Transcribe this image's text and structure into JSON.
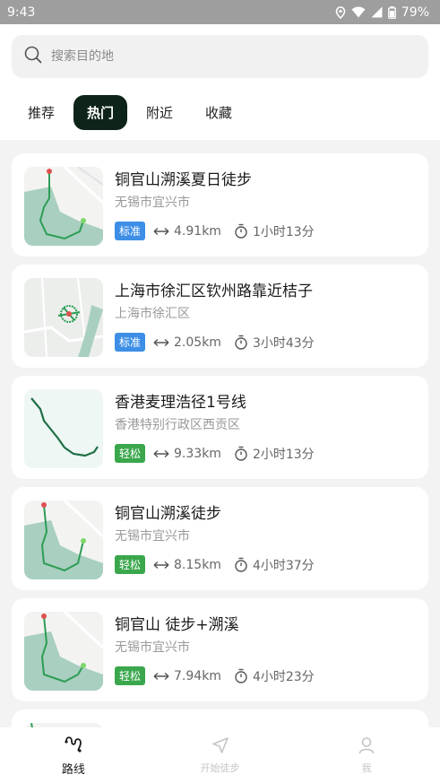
{
  "status_bar": {
    "time": "9:43",
    "battery": "79%"
  },
  "search": {
    "placeholder": "搜索目的地"
  },
  "tabs": [
    {
      "label": "推荐"
    },
    {
      "label": "热门",
      "active": true
    },
    {
      "label": "附近"
    },
    {
      "label": "收藏"
    }
  ],
  "routes": [
    {
      "title": "铜官山溯溪夏日徒步",
      "location": "无锡市宜兴市",
      "difficulty": "标准",
      "difficulty_color": "#3d8ee6",
      "distance": "4.91km",
      "duration": "1小时13分"
    },
    {
      "title": "上海市徐汇区钦州路靠近桔子",
      "location": "上海市徐汇区",
      "difficulty": "标准",
      "difficulty_color": "#3d8ee6",
      "distance": "2.05km",
      "duration": "3小时43分"
    },
    {
      "title": "香港麦理浩径1号线",
      "location": "香港特别行政区西贡区",
      "difficulty": "轻松",
      "difficulty_color": "#3aa74c",
      "distance": "9.33km",
      "duration": "2小时13分"
    },
    {
      "title": "铜官山溯溪徒步",
      "location": "无锡市宜兴市",
      "difficulty": "轻松",
      "difficulty_color": "#3aa74c",
      "distance": "8.15km",
      "duration": "4小时37分"
    },
    {
      "title": "铜官山 徒步+溯溪",
      "location": "无锡市宜兴市",
      "difficulty": "轻松",
      "difficulty_color": "#3aa74c",
      "distance": "7.94km",
      "duration": "4小时23分"
    }
  ],
  "bottom_nav": [
    {
      "label": "路线",
      "icon": "route-icon",
      "active": true
    },
    {
      "label": "开始徒步",
      "icon": "navigation-arrow-icon"
    },
    {
      "label": "我",
      "icon": "person-icon"
    }
  ]
}
